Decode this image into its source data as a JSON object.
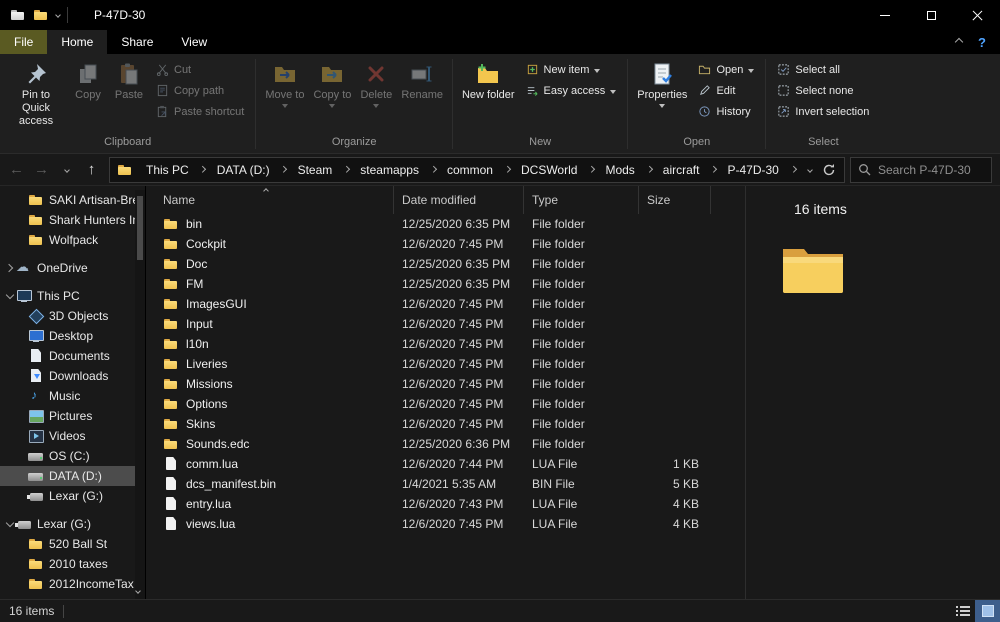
{
  "titlebar": {
    "title": "P-47D-30"
  },
  "ribbon": {
    "tabs": [
      {
        "label": "File",
        "file": true
      },
      {
        "label": "Home",
        "active": true
      },
      {
        "label": "Share"
      },
      {
        "label": "View"
      }
    ],
    "clipboard": {
      "label": "Clipboard",
      "pin": "Pin to Quick access",
      "copy": "Copy",
      "paste": "Paste",
      "cut": "Cut",
      "copy_path": "Copy path",
      "paste_shortcut": "Paste shortcut"
    },
    "organize": {
      "label": "Organize",
      "move_to": "Move to",
      "copy_to": "Copy to",
      "delete": "Delete",
      "rename": "Rename"
    },
    "new": {
      "label": "New",
      "new_folder": "New folder",
      "new_item": "New item",
      "easy_access": "Easy access"
    },
    "open": {
      "label": "Open",
      "properties": "Properties",
      "open": "Open",
      "edit": "Edit",
      "history": "History"
    },
    "select": {
      "label": "Select",
      "select_all": "Select all",
      "select_none": "Select none",
      "invert_selection": "Invert selection"
    }
  },
  "navbar": {
    "breadcrumb": [
      "This PC",
      "DATA (D:)",
      "Steam",
      "steamapps",
      "common",
      "DCSWorld",
      "Mods",
      "aircraft",
      "P-47D-30"
    ],
    "search_placeholder": "Search P-47D-30"
  },
  "sidebar": {
    "items": [
      {
        "label": "SAKI Artisan-Bre",
        "icon": "folder",
        "indent": 2
      },
      {
        "label": "Shark Hunters Inv",
        "icon": "folder",
        "indent": 2
      },
      {
        "label": "Wolfpack",
        "icon": "folder",
        "indent": 2
      },
      {
        "label": "OneDrive",
        "icon": "cloud",
        "indent": 1,
        "collapsed": true,
        "gap": true
      },
      {
        "label": "This PC",
        "icon": "pc",
        "indent": 1,
        "expanded": true,
        "gap": true
      },
      {
        "label": "3D Objects",
        "icon": "objects3d",
        "indent": 2
      },
      {
        "label": "Desktop",
        "icon": "desktop",
        "indent": 2
      },
      {
        "label": "Documents",
        "icon": "documents",
        "indent": 2
      },
      {
        "label": "Downloads",
        "icon": "downloads",
        "indent": 2
      },
      {
        "label": "Music",
        "icon": "music",
        "indent": 2
      },
      {
        "label": "Pictures",
        "icon": "pictures",
        "indent": 2
      },
      {
        "label": "Videos",
        "icon": "videos",
        "indent": 2
      },
      {
        "label": "OS (C:)",
        "icon": "drive",
        "indent": 2
      },
      {
        "label": "DATA (D:)",
        "icon": "drive",
        "indent": 2,
        "selected": true
      },
      {
        "label": "Lexar (G:)",
        "icon": "usb",
        "indent": 2
      },
      {
        "label": "Lexar (G:)",
        "icon": "usb",
        "indent": 1,
        "expanded": true,
        "gap": true
      },
      {
        "label": "520 Ball St",
        "icon": "folder",
        "indent": 2
      },
      {
        "label": "2010 taxes",
        "icon": "folder",
        "indent": 2
      },
      {
        "label": "2012IncomeTax",
        "icon": "folder",
        "indent": 2
      }
    ]
  },
  "filelist": {
    "columns": [
      "Name",
      "Date modified",
      "Type",
      "Size"
    ],
    "rows": [
      {
        "name": "bin",
        "date": "12/25/2020 6:35 PM",
        "type": "File folder",
        "size": "",
        "icon": "folder"
      },
      {
        "name": "Cockpit",
        "date": "12/6/2020 7:45 PM",
        "type": "File folder",
        "size": "",
        "icon": "folder"
      },
      {
        "name": "Doc",
        "date": "12/25/2020 6:35 PM",
        "type": "File folder",
        "size": "",
        "icon": "folder"
      },
      {
        "name": "FM",
        "date": "12/25/2020 6:35 PM",
        "type": "File folder",
        "size": "",
        "icon": "folder"
      },
      {
        "name": "ImagesGUI",
        "date": "12/6/2020 7:45 PM",
        "type": "File folder",
        "size": "",
        "icon": "folder"
      },
      {
        "name": "Input",
        "date": "12/6/2020 7:45 PM",
        "type": "File folder",
        "size": "",
        "icon": "folder"
      },
      {
        "name": "l10n",
        "date": "12/6/2020 7:45 PM",
        "type": "File folder",
        "size": "",
        "icon": "folder"
      },
      {
        "name": "Liveries",
        "date": "12/6/2020 7:45 PM",
        "type": "File folder",
        "size": "",
        "icon": "folder"
      },
      {
        "name": "Missions",
        "date": "12/6/2020 7:45 PM",
        "type": "File folder",
        "size": "",
        "icon": "folder"
      },
      {
        "name": "Options",
        "date": "12/6/2020 7:45 PM",
        "type": "File folder",
        "size": "",
        "icon": "folder"
      },
      {
        "name": "Skins",
        "date": "12/6/2020 7:45 PM",
        "type": "File folder",
        "size": "",
        "icon": "folder"
      },
      {
        "name": "Sounds.edc",
        "date": "12/25/2020 6:36 PM",
        "type": "File folder",
        "size": "",
        "icon": "folder"
      },
      {
        "name": "comm.lua",
        "date": "12/6/2020 7:44 PM",
        "type": "LUA File",
        "size": "1 KB",
        "icon": "file"
      },
      {
        "name": "dcs_manifest.bin",
        "date": "1/4/2021 5:35 AM",
        "type": "BIN File",
        "size": "5 KB",
        "icon": "file"
      },
      {
        "name": "entry.lua",
        "date": "12/6/2020 7:43 PM",
        "type": "LUA File",
        "size": "4 KB",
        "icon": "file"
      },
      {
        "name": "views.lua",
        "date": "12/6/2020 7:45 PM",
        "type": "LUA File",
        "size": "4 KB",
        "icon": "file"
      }
    ]
  },
  "preview": {
    "items_count": "16 items"
  },
  "statusbar": {
    "items_count": "16 items"
  },
  "colors": {
    "file_tab_accent": "#5a5a22",
    "folder_yellow": "#f3c64e",
    "selection_gray": "#4c4c4c",
    "titlebar_black": "#000000"
  }
}
